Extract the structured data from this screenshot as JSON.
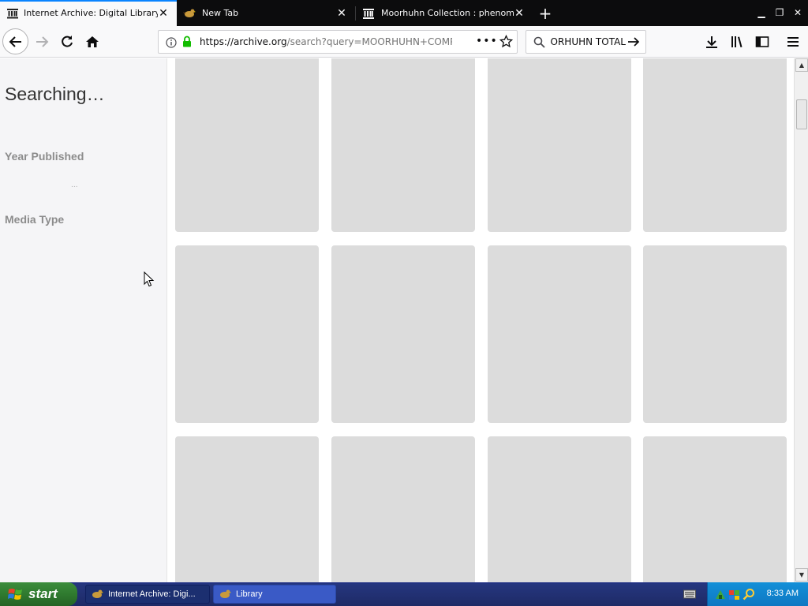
{
  "tabs": [
    {
      "title": "Internet Archive: Digital Library of",
      "icon": "archive-icon",
      "active": true
    },
    {
      "title": "New Tab",
      "icon": "moorhuhn-icon",
      "active": false
    },
    {
      "title": "Moorhuhn Collection : phenomedia",
      "icon": "archive-temple-icon",
      "active": false
    }
  ],
  "navbar": {
    "url_host": "https://archive.org",
    "url_rest": "/search?query=MOORHUHN+COMPL",
    "search_value": "MOORHUHN TOTAL"
  },
  "sidebar": {
    "status": "Searching…",
    "facets": [
      "Year Published",
      "Media Type"
    ],
    "loader": "..."
  },
  "results": {
    "placeholder_tiles": 12,
    "columns": 4
  },
  "taskbar": {
    "start_label": "start",
    "items": [
      {
        "label": "Internet Archive: Digi...",
        "icon": "firefox-icon",
        "active": true
      },
      {
        "label": "Library",
        "icon": "firefox-icon",
        "active": false
      }
    ],
    "clock": "8:33 AM"
  },
  "colors": {
    "tab_bg": "#0c0c0d",
    "accent": "#0a84ff",
    "lock_green": "#12bc00",
    "placeholder_tile": "#dcdcdc",
    "taskbar": "#24367f",
    "start_green": "#2f7a2f"
  }
}
